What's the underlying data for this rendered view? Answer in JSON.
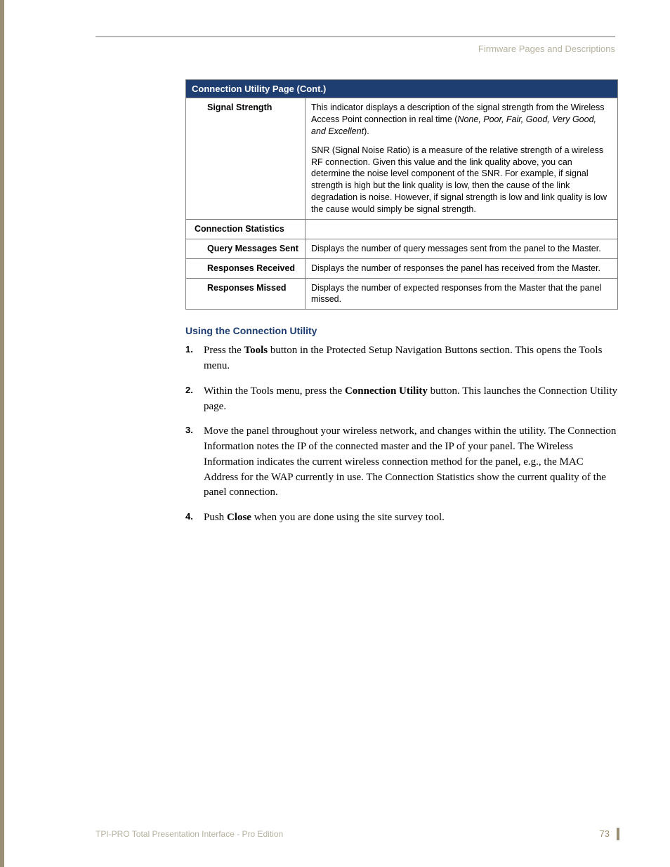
{
  "header": {
    "section_title": "Firmware Pages and Descriptions"
  },
  "table": {
    "title": "Connection Utility Page (Cont.)",
    "rows": [
      {
        "label": "Signal Strength",
        "indent": true,
        "desc1_a": "This indicator displays a description of the signal strength from the Wireless Access Point connection in real time (",
        "desc1_b": "None, Poor, Fair, Good, Very Good, and Excellent",
        "desc1_c": ").",
        "desc2": "SNR (Signal Noise Ratio) is a measure of the relative strength of a wireless RF connection. Given this value and the link quality above, you can determine the noise level component of the SNR. For example, if signal strength is high but the link quality is low, then the cause of the link degradation is noise. However, if signal strength is low and link quality is low the cause would simply be signal strength."
      },
      {
        "label": "Connection Statistics",
        "indent": false,
        "desc": ""
      },
      {
        "label": "Query Messages Sent",
        "indent": true,
        "desc": "Displays the number of query messages sent from the panel to the Master."
      },
      {
        "label": "Responses Received",
        "indent": true,
        "desc": "Displays the number of responses the panel has received from the Master."
      },
      {
        "label": "Responses Missed",
        "indent": true,
        "desc": "Displays the number of expected responses from the Master that the panel missed."
      }
    ]
  },
  "section_heading": "Using the Connection Utility",
  "steps": {
    "s1a": "Press the ",
    "s1b": "Tools",
    "s1c": " button in the Protected Setup Navigation Buttons section. This opens the Tools menu.",
    "s2a": "Within the Tools menu, press the ",
    "s2b": "Connection Utility",
    "s2c": " button. This launches the Connection Utility page.",
    "s3": "Move the panel throughout your wireless network, and changes within the utility. The Connection Information notes the IP of the connected master and the IP of your panel. The Wireless Information indicates the current wireless connection method for the panel, e.g., the MAC Address for the WAP currently in use. The Connection Statistics show the current quality of the panel connection.",
    "s4a": "Push ",
    "s4b": "Close",
    "s4c": " when you are done using the site survey tool."
  },
  "footer": {
    "doc_title": "TPI-PRO Total Presentation Interface - Pro Edition",
    "page_number": "73"
  }
}
